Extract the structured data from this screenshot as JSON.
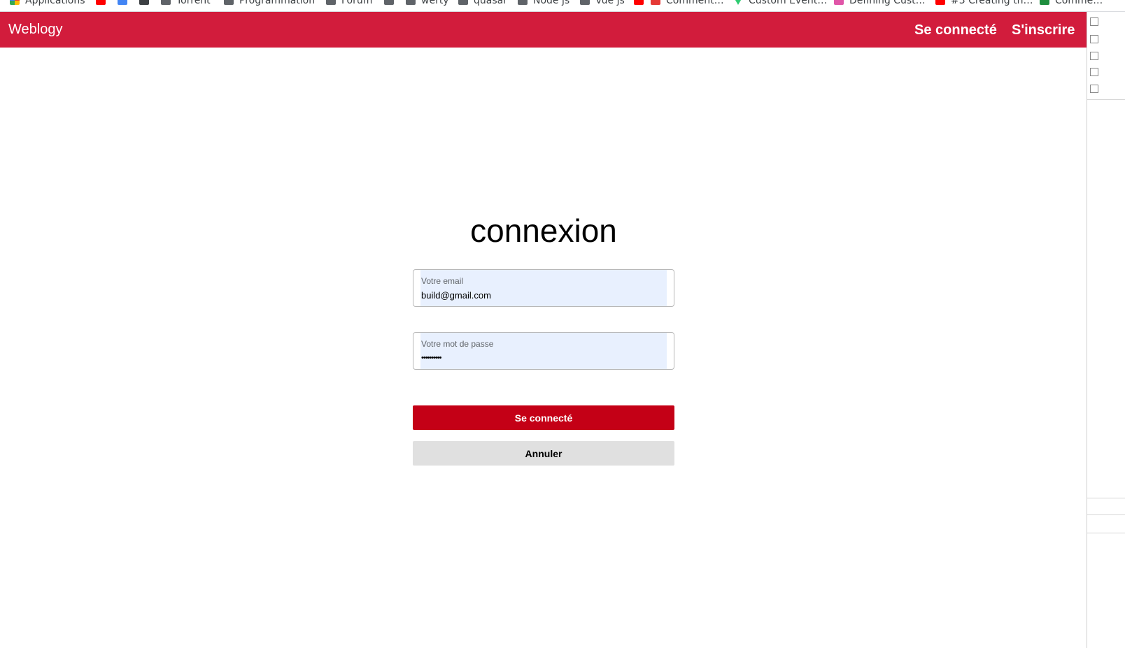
{
  "bookmarks": [
    {
      "label": "Applications",
      "icon": "apps-icon"
    },
    {
      "label": "",
      "icon": "youtube-icon"
    },
    {
      "label": "",
      "icon": "doc-icon"
    },
    {
      "label": "",
      "icon": "circle-icon"
    },
    {
      "label": "Torrent",
      "icon": "folder-icon"
    },
    {
      "label": "Programmation",
      "icon": "folder-icon"
    },
    {
      "label": "Forum",
      "icon": "folder-icon"
    },
    {
      "label": "",
      "icon": "gear-icon"
    },
    {
      "label": "werty",
      "icon": "folder-icon"
    },
    {
      "label": "quasar",
      "icon": "folder-icon"
    },
    {
      "label": "Node js",
      "icon": "folder-icon"
    },
    {
      "label": "Vue js",
      "icon": "folder-icon"
    },
    {
      "label": "",
      "icon": "youtube-icon"
    },
    {
      "label": "Comment…",
      "icon": "red-circle-icon"
    },
    {
      "label": "Custom Event…",
      "icon": "vue-icon"
    },
    {
      "label": "Defining Cust…",
      "icon": "pink-icon"
    },
    {
      "label": "#3 Creating th…",
      "icon": "youtube-icon"
    },
    {
      "label": "Comme…",
      "icon": "green-icon"
    }
  ],
  "header": {
    "brand": "Weblogy",
    "login_link": "Se connecté",
    "signup_link": "S'inscrire",
    "color": "#d21c3c"
  },
  "form": {
    "title": "connexion",
    "email_label": "Votre email",
    "email_value": "build@gmail.com",
    "password_label": "Votre mot de passe",
    "password_value": "••••••••••",
    "submit_label": "Se connecté",
    "cancel_label": "Annuler",
    "submit_color": "#c40016",
    "autofill_color": "#e8f0fe"
  }
}
